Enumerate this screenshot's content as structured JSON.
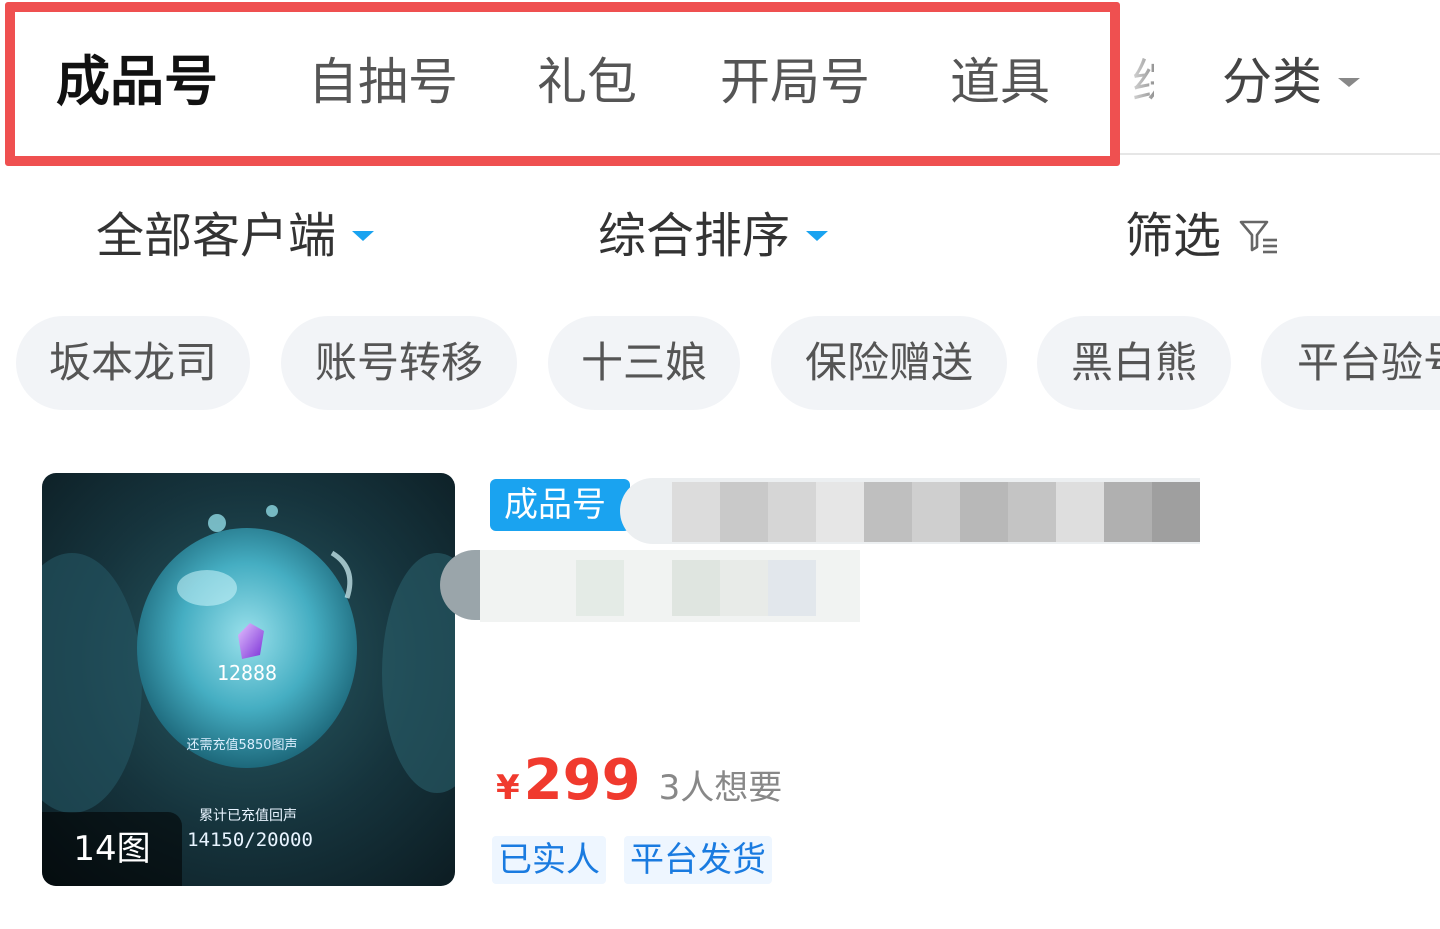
{
  "top_tabs": {
    "items": [
      {
        "label": "成品号",
        "active": true
      },
      {
        "label": "自抽号"
      },
      {
        "label": "礼包"
      },
      {
        "label": "开局号"
      },
      {
        "label": "道具"
      }
    ],
    "partial_tab": "综",
    "category_label": "分类",
    "highlight_color": "#ef5050"
  },
  "filters": {
    "client": "全部客户端",
    "sort": "综合排序",
    "screen": "筛选",
    "accent_color": "#1aa3f0"
  },
  "chips": [
    "坂本龙司",
    "账号转移",
    "十三娘",
    "保险赠送",
    "黑白熊",
    "平台验号"
  ],
  "listing": {
    "image_count": "14图",
    "thumb_texts": {
      "crystal_value": "12888",
      "recharge_text": "还需充值5850图声",
      "cumulative_text": "累计已充值回声",
      "progress": "14150/20000"
    },
    "tag": "成品号",
    "price_currency": "¥",
    "price": "299",
    "wants": "3人想要",
    "badges": [
      "已实人",
      "平台发货"
    ],
    "price_color": "#f03a2e"
  }
}
